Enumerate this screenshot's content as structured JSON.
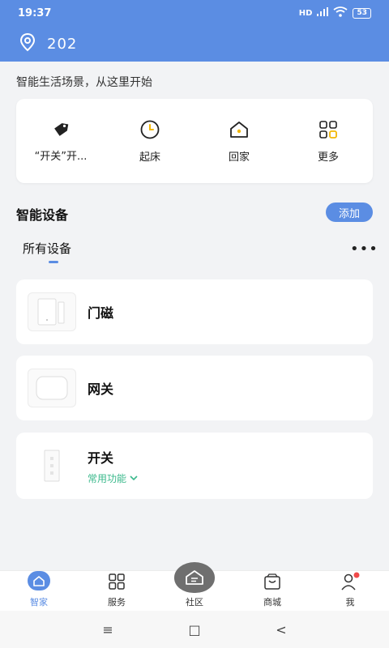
{
  "status_bar": {
    "time": "19:37",
    "network": "HD",
    "battery": "53"
  },
  "header": {
    "room": "202"
  },
  "tagline": "智能生活场景，从这里开始",
  "scenes": [
    {
      "label": "“开关”开...",
      "icon": "tag-icon"
    },
    {
      "label": "起床",
      "icon": "clock-icon"
    },
    {
      "label": "回家",
      "icon": "home-icon"
    },
    {
      "label": "更多",
      "icon": "grid-icon"
    }
  ],
  "devices_section": {
    "title": "智能设备",
    "add_label": "添加",
    "tab_label": "所有设备",
    "more": "•••"
  },
  "devices": [
    {
      "name": "门磁",
      "icon": "door-sensor-icon"
    },
    {
      "name": "网关",
      "icon": "gateway-icon"
    },
    {
      "name": "开关",
      "subtitle": "常用功能",
      "icon": "wall-switch-icon"
    }
  ],
  "tabbar": [
    {
      "label": "智家",
      "icon": "home-icon",
      "active": true
    },
    {
      "label": "服务",
      "icon": "grid-icon"
    },
    {
      "label": "社区",
      "icon": "community-icon"
    },
    {
      "label": "商城",
      "icon": "shopping-bag-icon"
    },
    {
      "label": "我",
      "icon": "person-icon",
      "badge": true
    }
  ],
  "nav_bar": {
    "menu": "≡",
    "home": "□",
    "back": "<"
  },
  "colors": {
    "accent": "#5b8de3",
    "green": "#3bb98c",
    "badge": "#f04a4a",
    "scene_yellow": "#f2b705"
  }
}
